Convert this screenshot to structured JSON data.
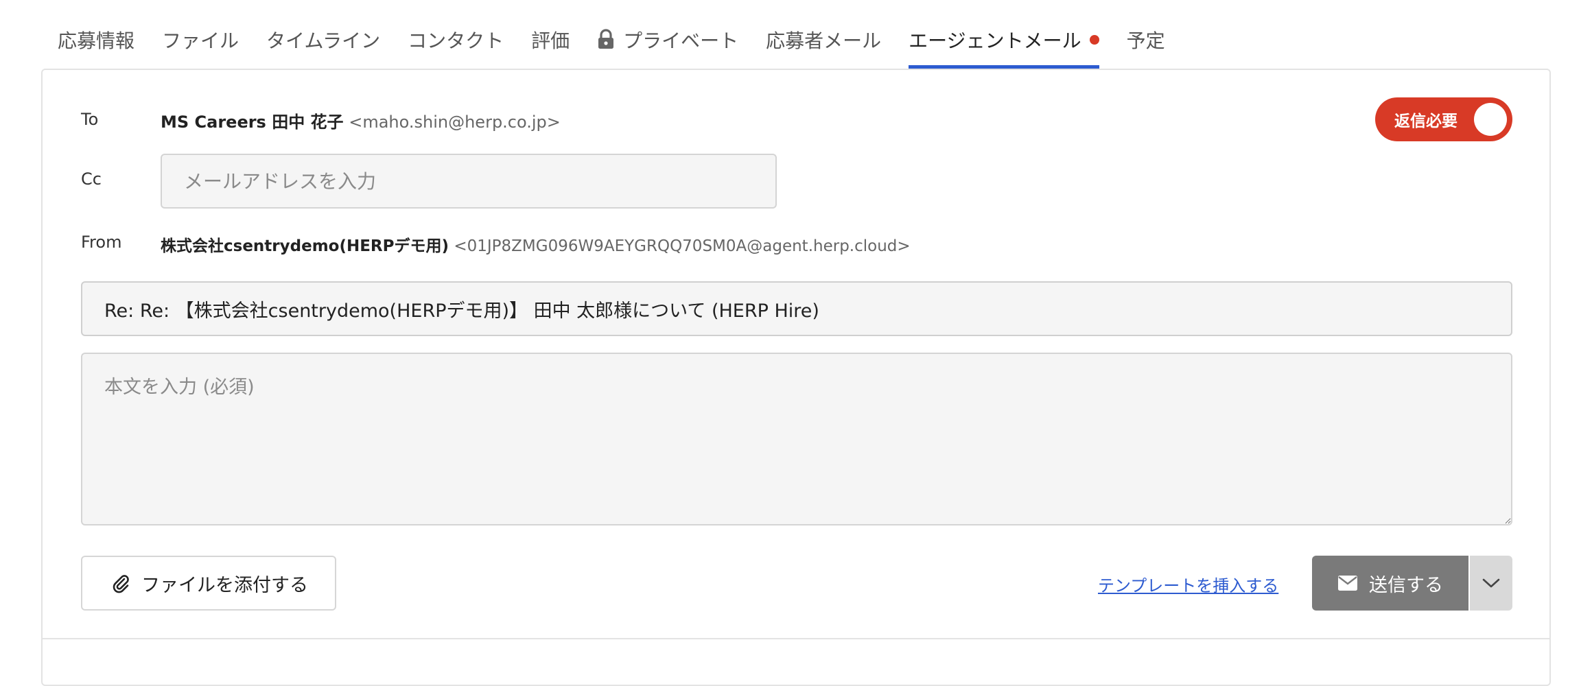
{
  "colors": {
    "accent": "#2d5bd0",
    "required_toggle": "#d83a26",
    "new_dot": "#d83a26",
    "send_button": "#7a7a7a"
  },
  "tabs": [
    {
      "label": "応募情報",
      "active": false
    },
    {
      "label": "ファイル",
      "active": false
    },
    {
      "label": "タイムライン",
      "active": false
    },
    {
      "label": "コンタクト",
      "active": false
    },
    {
      "label": "評価",
      "active": false
    },
    {
      "label": "プライベート",
      "active": false,
      "icon": "lock-icon"
    },
    {
      "label": "応募者メール",
      "active": false
    },
    {
      "label": "エージェントメール",
      "active": true,
      "badge": "red-dot"
    },
    {
      "label": "予定",
      "active": false
    }
  ],
  "form": {
    "to_label": "To",
    "to_name": "MS Careers 田中 花子",
    "to_email": "<maho.shin@herp.co.jp>",
    "cc_label": "Cc",
    "cc_placeholder": "メールアドレスを入力",
    "from_label": "From",
    "from_name": "株式会社csentrydemo(HERPデモ用)",
    "from_email": "<01JP8ZMG096W9AEYGRQQ70SM0A@agent.herp.cloud>",
    "subject_value": "Re: Re: 【株式会社csentrydemo(HERPデモ用)】 田中 太郎様について (HERP Hire)",
    "body_placeholder": "本文を入力 (必須)"
  },
  "toggle": {
    "label": "返信必要",
    "on": true
  },
  "actions": {
    "attach_label": "ファイルを添付する",
    "template_link": "テンプレートを挿入する",
    "send_label": "送信する"
  }
}
